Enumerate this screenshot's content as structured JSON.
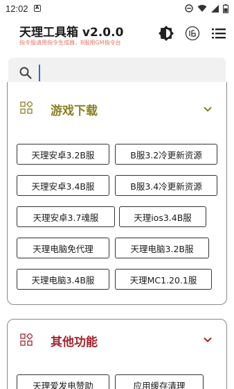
{
  "status_bar": {
    "time": "12:02",
    "notification_glyph": "A"
  },
  "header": {
    "title": "天理工具箱 v2.0.0",
    "subtitle": "指令服请用指令生成器，B服用GM指令台"
  },
  "search": {
    "value": "",
    "placeholder": ""
  },
  "sections": {
    "games": {
      "title": "游戏下载",
      "buttons": [
        "天理安卓3.2B服",
        "B服3.2冷更新资源",
        "天理安卓3.4B服",
        "B服3.4冷更新资源",
        "天理安卓3.7魂服",
        "天理ios3.4B服",
        "天理电脑免代理",
        "天理电脑3.2B服",
        "天理电脑3.4B服",
        "天理MC1.20.1服"
      ]
    },
    "other": {
      "title": "其他功能",
      "buttons": [
        "天理爱发电赞助",
        "应用缓存清理"
      ]
    }
  },
  "colors": {
    "games_title": "#8a7f1e",
    "other_title": "#a3232b",
    "subtitle": "#e07a6a",
    "cursor": "#1e6fd6"
  },
  "icons": {
    "theme": "brightness-icon",
    "vpn": "vpn-badge-icon",
    "menu": "menu-icon",
    "search": "search-icon",
    "section": "apps-grid-icon",
    "expand": "chevron-down-icon"
  }
}
